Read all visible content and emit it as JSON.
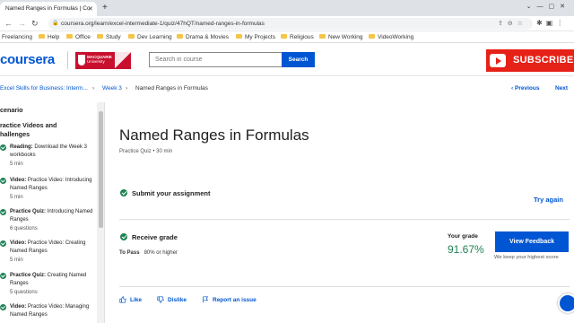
{
  "browser": {
    "tab_title": "Named Ranges in Formulas | Co",
    "url": "coursera.org/learn/excel-intermediate-1/quiz/47hQT/named-ranges-in-formulas",
    "bookmarks": [
      "Freelancing",
      "Help",
      "Office",
      "Study",
      "Dev Learning",
      "Drama & Movies",
      "My Projects",
      "Religious",
      "New Working",
      "VideoWorking"
    ]
  },
  "header": {
    "logo": "coursera",
    "partner_name": "MACQUARIE",
    "partner_sub": "University",
    "search_placeholder": "Search in course",
    "search_button": "Search",
    "subscribe_label": "SUBSCRIBE"
  },
  "breadcrumb": {
    "items": [
      "Excel Skills for Business: Interm...",
      "Week 3",
      "Named Ranges in Formulas"
    ],
    "previous": "Previous",
    "next": "Next"
  },
  "sidebar": {
    "section1": "cenario",
    "section2_line1": "ractice Videos and",
    "section2_line2": "hallenges",
    "items": [
      {
        "type": "Reading:",
        "title": " Download the Week 3 workbooks",
        "meta": "5 min"
      },
      {
        "type": "Video:",
        "title": " Practice Video: Introducing Named Ranges",
        "meta": "5 min"
      },
      {
        "type": "Practice Quiz:",
        "title": " Introducing Named Ranges",
        "meta": "6 questions"
      },
      {
        "type": "Video:",
        "title": " Practice Video: Creating Named Ranges",
        "meta": "5 min"
      },
      {
        "type": "Practice Quiz:",
        "title": " Creating Named Ranges",
        "meta": "5 questions"
      },
      {
        "type": "Video:",
        "title": " Practice Video: Managing Named Ranges",
        "meta": ""
      }
    ]
  },
  "main": {
    "title": "Named Ranges in Formulas",
    "subtitle": "Practice Quiz • 30 min",
    "submit_label": "Submit your assignment",
    "try_again": "Try again",
    "receive_grade": "Receive grade",
    "to_pass_label": "To Pass",
    "to_pass_value": "80% or higher",
    "your_grade_label": "Your grade",
    "grade_value": "91.67%",
    "view_feedback": "View Feedback",
    "keep_note": "We keep your highest score",
    "like": "Like",
    "dislike": "Dislike",
    "report": "Report an issue"
  },
  "colors": {
    "brand": "#0056d2",
    "success": "#1f8354",
    "youtube": "#e62117",
    "partner": "#c8102e"
  }
}
